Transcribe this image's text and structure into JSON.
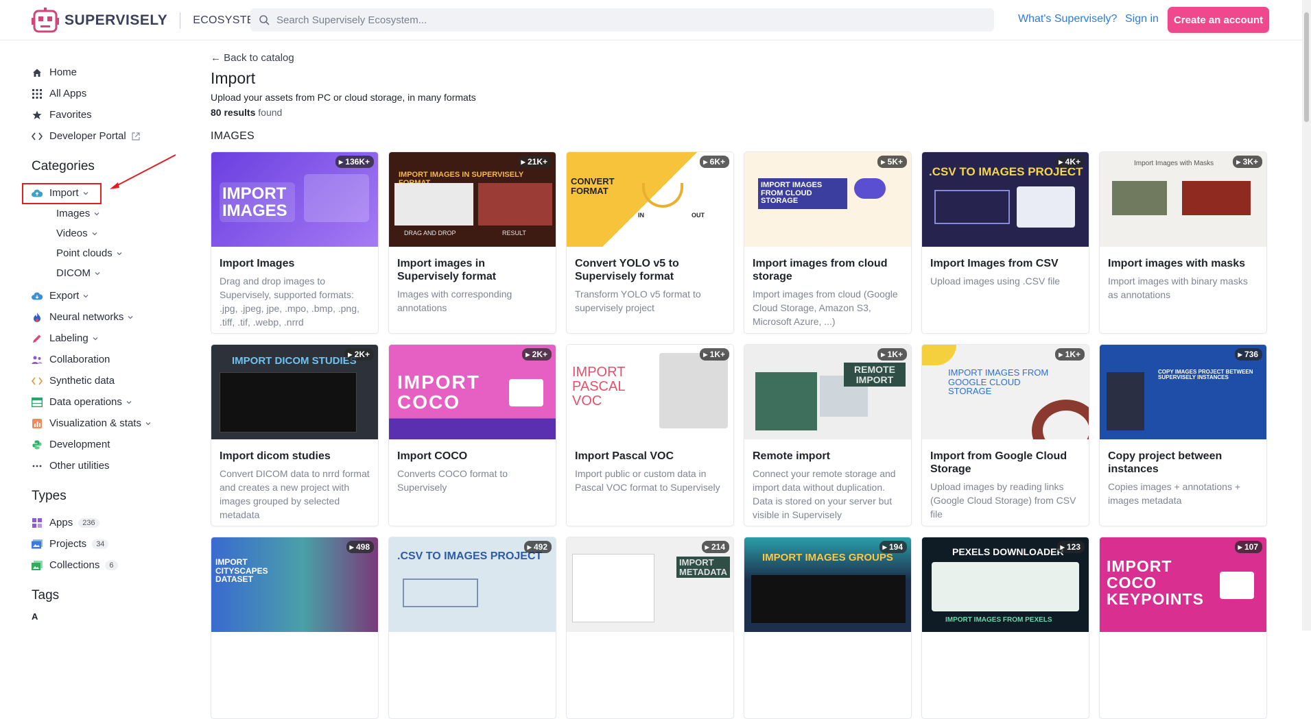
{
  "header": {
    "logo_text": "SUPERVISELY",
    "logo_sub": "ECOSYSTEM",
    "search_placeholder": "Search Supervisely Ecosystem...",
    "whats_link": "What's Supervisely?",
    "signin_link": "Sign in",
    "cta_label": "Create an account",
    "accent": "#f0488d",
    "link_color": "#2d7be0"
  },
  "sidebar": {
    "nav": [
      {
        "label": "Home",
        "icon": "home-icon"
      },
      {
        "label": "All Apps",
        "icon": "grid-icon"
      },
      {
        "label": "Favorites",
        "icon": "star-icon"
      },
      {
        "label": "Developer Portal",
        "icon": "code-icon"
      }
    ],
    "categories_title": "Categories",
    "categories": [
      {
        "label": "Import",
        "icon": "cloud-upload-icon",
        "expanded": true
      },
      {
        "label": "Export",
        "icon": "cloud-download-icon"
      },
      {
        "label": "Neural networks",
        "icon": "flame-icon"
      },
      {
        "label": "Labeling",
        "icon": "pencil-icon"
      },
      {
        "label": "Collaboration",
        "icon": "people-icon"
      },
      {
        "label": "Synthetic data",
        "icon": "code-icon"
      },
      {
        "label": "Data operations",
        "icon": "table-icon"
      },
      {
        "label": "Visualization & stats",
        "icon": "chart-icon"
      },
      {
        "label": "Development",
        "icon": "python-icon"
      },
      {
        "label": "Other utilities",
        "icon": "dots-icon"
      }
    ],
    "import_sub": [
      "Images",
      "Videos",
      "Point clouds",
      "DICOM"
    ],
    "types_title": "Types",
    "types": [
      {
        "label": "Apps",
        "count": "236",
        "icon": "apps-icon"
      },
      {
        "label": "Projects",
        "count": "34",
        "icon": "projects-icon"
      },
      {
        "label": "Collections",
        "count": "6",
        "icon": "collections-icon"
      }
    ],
    "tags_title": "Tags",
    "tags_letter": "A"
  },
  "main": {
    "back": "← Back to catalog",
    "title": "Import",
    "subtitle": "Upload your assets from PC or cloud storage, in many formats",
    "results_count": "80 results",
    "results_suffix": " found",
    "section": "IMAGES"
  },
  "cards": [
    {
      "title": "Import Images",
      "desc": "Drag and drop images to Supervisely, supported formats: .jpg, .jpeg, jpe, .mpo, .bmp, .png, .tiff, .tif, .webp, .nrrd",
      "badge": "136K+",
      "thumb_text": "IMPORT IMAGES",
      "thumb_bg": "#7b4ee8"
    },
    {
      "title": "Import images in Supervisely format",
      "desc": "Images with corresponding annotations",
      "badge": "21K+",
      "thumb_text": "IMPORT IMAGES IN SUPERVISELY FORMAT",
      "thumb_bg": "#4a1f14",
      "thumb_sub_left": "DRAG AND DROP",
      "thumb_sub_right": "RESULT"
    },
    {
      "title": "Convert YOLO v5 to Supervisely format",
      "desc": "Transform YOLO v5 format to supervisely project",
      "badge": "6K+",
      "thumb_text": "CONVERT FORMAT",
      "thumb_bg": "#f6c33b",
      "thumb_in": "IN",
      "thumb_out": "OUT"
    },
    {
      "title": "Import images from cloud storage",
      "desc": "Import images from cloud (Google Cloud Storage, Amazon S3, Microsoft Azure, ...)",
      "badge": "5K+",
      "thumb_text": "IMPORT IMAGES FROM CLOUD STORAGE",
      "thumb_bg": "#fdf3e2"
    },
    {
      "title": "Import Images from CSV",
      "desc": "Upload images using .CSV file",
      "badge": "4K+",
      "thumb_text": ".CSV TO IMAGES PROJECT",
      "thumb_bg": "#26244f"
    },
    {
      "title": "Import images with masks",
      "desc": "Import images with binary masks as annotations",
      "badge": "3K+",
      "thumb_text": "Import Images with Masks",
      "thumb_bg": "#f2f0ec"
    },
    {
      "title": "Import dicom studies",
      "desc": "Convert DICOM data to nrrd format and creates a new project with images grouped by selected metadata",
      "badge": "2K+",
      "thumb_text": "IMPORT DICOM STUDIES",
      "thumb_bg": "#2c313a"
    },
    {
      "title": "Import COCO",
      "desc": "Converts COCO format to Supervisely",
      "badge": "2K+",
      "thumb_text": "IMPORT COCO",
      "thumb_bg": "#e65fc2"
    },
    {
      "title": "Import Pascal VOC",
      "desc": "Import public or custom data in Pascal VOC format to Supervisely",
      "badge": "1K+",
      "thumb_text": "IMPORT PASCAL VOC",
      "thumb_bg": "#ffffff"
    },
    {
      "title": "Remote import",
      "desc": "Connect your remote storage and import data without duplication. Data is stored on your server but visible in Supervisely",
      "badge": "1K+",
      "thumb_text": "REMOTE IMPORT",
      "thumb_bg": "#eeeeee"
    },
    {
      "title": "Import from Google Cloud Storage",
      "desc": "Upload images by reading links (Google Cloud Storage) from CSV file",
      "badge": "1K+",
      "thumb_text": "IMPORT IMAGES FROM GOOGLE CLOUD STORAGE",
      "thumb_bg": "#f1f1f1"
    },
    {
      "title": "Copy project between instances",
      "desc": "Copies images + annotations + images metadata",
      "badge": "736",
      "thumb_text": "COPY IMAGES PROJECT BETWEEN SUPERVISELY INSTANCES",
      "thumb_bg": "#1e4ea8"
    },
    {
      "title": "",
      "desc": "",
      "badge": "498",
      "thumb_text": "IMPORT CITYSCAPES DATASET",
      "thumb_bg": "#3a6ad0"
    },
    {
      "title": "",
      "desc": "",
      "badge": "492",
      "thumb_text": ".CSV TO IMAGES PROJECT",
      "thumb_bg": "#dbe7ef"
    },
    {
      "title": "",
      "desc": "",
      "badge": "214",
      "thumb_text": "IMPORT METADATA",
      "thumb_bg": "#f0f0f0"
    },
    {
      "title": "",
      "desc": "",
      "badge": "194",
      "thumb_text": "IMPORT IMAGES GROUPS",
      "thumb_bg": "#1d2f4d"
    },
    {
      "title": "",
      "desc": "",
      "badge": "123",
      "thumb_text": "PEXELS DOWNLOADER",
      "thumb_bg": "#0f1b25",
      "thumb_sub": "IMPORT IMAGES FROM PEXELS"
    },
    {
      "title": "",
      "desc": "",
      "badge": "107",
      "thumb_text": "IMPORT COCO KEYPOINTS",
      "thumb_bg": "#d92f90"
    }
  ]
}
